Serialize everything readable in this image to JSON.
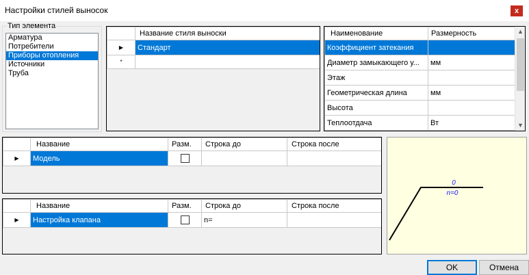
{
  "window": {
    "title": "Настройки стилей выносок",
    "close_label": "x"
  },
  "element_type": {
    "group_label": "Тип элемента",
    "items": [
      "Арматура",
      "Потребители",
      "Приборы отопления",
      "Источники",
      "Труба"
    ],
    "selected_index": 2
  },
  "styles_grid": {
    "header": "Название стиля выноски",
    "row_marker": "▶",
    "new_marker": "*",
    "rows": [
      "Стандарт"
    ]
  },
  "params_grid": {
    "headers": [
      "Наименование",
      "Размерность"
    ],
    "rows": [
      [
        "Коэффициент затекания",
        ""
      ],
      [
        "Диаметр замыкающего у...",
        "мм"
      ],
      [
        "Этаж",
        ""
      ],
      [
        "Геометрическая длина",
        "мм"
      ],
      [
        "Высота",
        ""
      ],
      [
        "Теплоотдача",
        "Вт"
      ]
    ],
    "scroll_up": "▲",
    "scroll_down": "▼"
  },
  "top_line_grid": {
    "headers": [
      "Название",
      "Разм.",
      "Строка до",
      "Строка после"
    ],
    "row": {
      "name": "Модель",
      "checked": false,
      "before": "",
      "after": ""
    }
  },
  "bottom_line_grid": {
    "headers": [
      "Название",
      "Разм.",
      "Строка до",
      "Строка после"
    ],
    "row": {
      "name": "Настройка клапана",
      "checked": false,
      "before": "n=",
      "after": ""
    }
  },
  "preview": {
    "top_text": "0",
    "bottom_text": "n=0",
    "text_color": "#1a1aff"
  },
  "buttons": {
    "ok": "OK",
    "cancel": "Отмена"
  }
}
